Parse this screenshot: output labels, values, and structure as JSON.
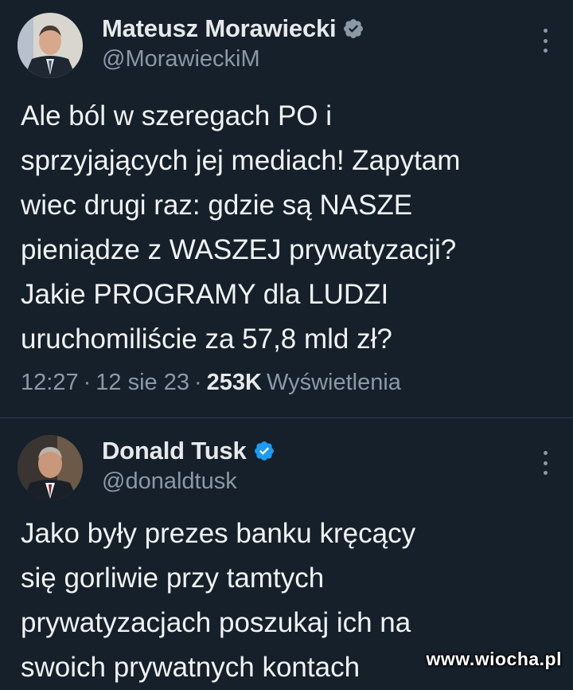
{
  "tweets": [
    {
      "author_name": "Mateusz Morawiecki",
      "author_handle": "@MorawieckiM",
      "verified_badge_color": "#8b98a5",
      "text": "Ale ból w szeregach PO i\nsprzyjających jej mediach! Zapytam\nwiec drugi raz: gdzie są NASZE\npieniądze z WASZEJ prywatyzacji?\nJakie PROGRAMY dla LUDZI\nuruchomiliście za 57,8 mld zł?",
      "time": "12:27",
      "date": "12 sie 23",
      "views_count": "253K",
      "views_label": "Wyświetlenia",
      "separator": "·",
      "more_icon": "more-vertical-icon"
    },
    {
      "author_name": "Donald Tusk",
      "author_handle": "@donaldtusk",
      "verified_badge_color": "#1d9bf0",
      "text": "Jako były prezes banku kręcący\nsię gorliwie przy tamtych\nprywatyzacjach poszukaj ich na\nswoich prywatnych kontach",
      "more_icon": "more-vertical-icon"
    }
  ],
  "watermark": "www.wiocha.pl",
  "colors": {
    "background": "#15202b",
    "text_primary": "#e7e9ea",
    "text_secondary": "#8b98a5",
    "verified_blue": "#1d9bf0"
  }
}
